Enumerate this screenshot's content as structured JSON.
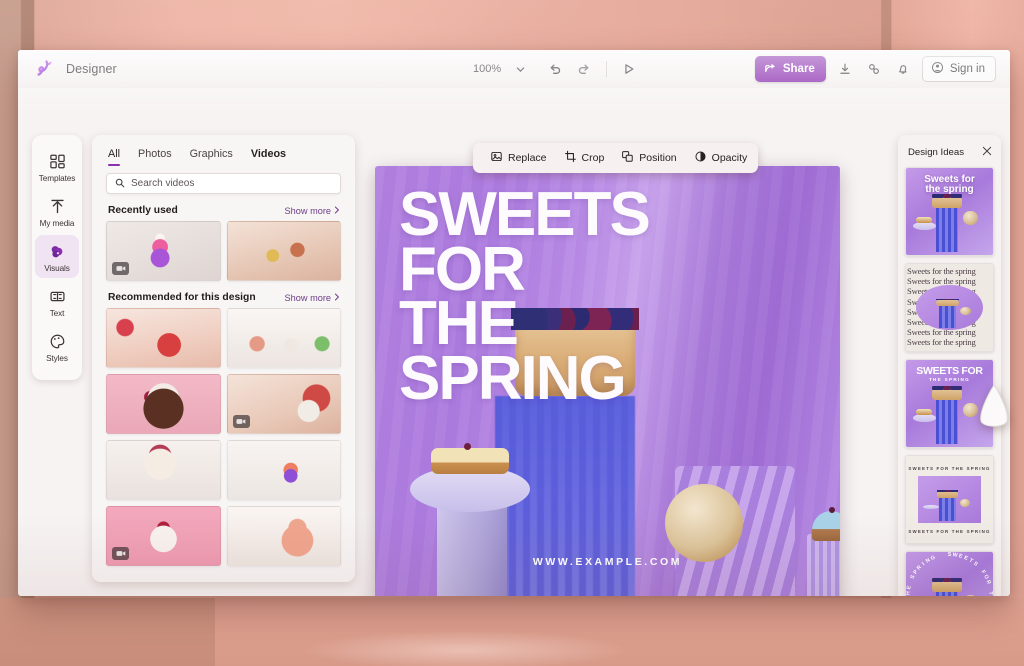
{
  "app": {
    "title": "Designer",
    "logo_icon": "designer-logo-icon"
  },
  "titlebar": {
    "zoom_level": "100%",
    "zoom_caret_icon": "chevron-down-icon",
    "undo_icon": "undo-icon",
    "redo_icon": "redo-icon",
    "play_icon": "play-icon",
    "share_label": "Share",
    "share_icon": "share-icon",
    "share_color": "#8b2fb0",
    "download_icon": "download-icon",
    "link_icon": "link-icon",
    "notification_icon": "bell-icon",
    "signin_label": "Sign in",
    "signin_icon": "person-circle-icon"
  },
  "sidebar": {
    "items": [
      {
        "label": "Templates",
        "icon": "templates-grid-icon",
        "active": false
      },
      {
        "label": "My media",
        "icon": "upload-arrow-icon",
        "active": false
      },
      {
        "label": "Visuals",
        "icon": "visuals-bubbles-icon",
        "active": true
      },
      {
        "label": "Text",
        "icon": "text-box-icon",
        "active": false
      },
      {
        "label": "Styles",
        "icon": "styles-palette-icon",
        "active": false
      }
    ],
    "active_bg": "#f0e4f3"
  },
  "panel": {
    "tabs": [
      {
        "label": "All",
        "active": true,
        "bold": false
      },
      {
        "label": "Photos",
        "active": false,
        "bold": false
      },
      {
        "label": "Graphics",
        "active": false,
        "bold": false
      },
      {
        "label": "Videos",
        "active": false,
        "bold": true
      }
    ],
    "active_underline_color": "#8b2fb0",
    "search": {
      "placeholder": "Search videos",
      "value": "",
      "icon": "search-icon"
    },
    "sections": [
      {
        "title": "Recently used",
        "show_more": "Show more",
        "show_more_icon": "chevron-right-icon",
        "items": [
          {
            "art": "t-cake1",
            "video": true
          },
          {
            "art": "t-table1",
            "video": false
          }
        ]
      },
      {
        "title": "Recommended for this design",
        "show_more": "Show more",
        "show_more_icon": "chevron-right-icon",
        "items": [
          {
            "art": "t-lemon",
            "video": false
          },
          {
            "art": "t-trio",
            "video": false
          },
          {
            "art": "t-choc",
            "video": false
          },
          {
            "art": "t-mug",
            "video": true
          },
          {
            "art": "t-tier",
            "video": false
          },
          {
            "art": "t-cup",
            "video": false
          },
          {
            "art": "t-pudding",
            "video": true
          },
          {
            "art": "t-macaron",
            "video": false
          }
        ]
      }
    ]
  },
  "float_toolbar": {
    "items": [
      {
        "label": "Replace",
        "icon": "image-replace-icon"
      },
      {
        "label": "Crop",
        "icon": "crop-icon"
      },
      {
        "label": "Position",
        "icon": "position-layers-icon"
      },
      {
        "label": "Opacity",
        "icon": "opacity-circle-icon"
      }
    ]
  },
  "canvas": {
    "poster_title": "SWEETS\nFOR\nTHE\nSPRING",
    "poster_url": "WWW.EXAMPLE.COM",
    "title_color": "#fdfbfe",
    "background_colors": [
      "#b282e0",
      "#a97ad9",
      "#c9a4ec",
      "#4a4fd4"
    ]
  },
  "design_ideas": {
    "title": "Design Ideas",
    "close_icon": "close-icon",
    "ideas": [
      {
        "style": "title-overlay",
        "title": "Sweets for\nthe spring"
      },
      {
        "style": "repeat-text",
        "line": "Sweets for the spring",
        "lines": 8
      },
      {
        "style": "stacked-title",
        "title": "SWEETS FOR",
        "subtitle": "THE SPRING"
      },
      {
        "style": "framed",
        "top_text": "SWEETS FOR THE SPRING",
        "bottom_text": "SWEETS FOR THE SPRING"
      },
      {
        "style": "circular-text",
        "title": "SWEETS FOR THE SPRING  SWEETS FOR THE SPRING  "
      }
    ]
  },
  "cursor": {
    "icon": "pointer-cursor-icon"
  }
}
